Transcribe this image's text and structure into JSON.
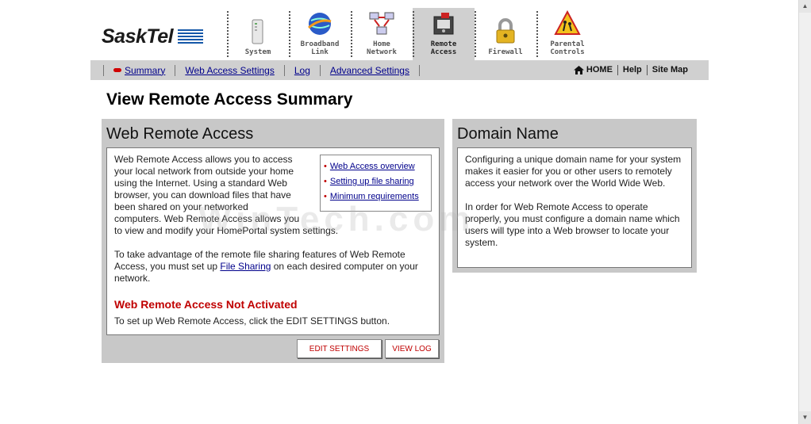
{
  "brand": {
    "name": "SaskTel"
  },
  "nav_tabs": [
    {
      "label_line1": "System",
      "label_line2": "",
      "icon": "system-tower-icon",
      "active": false
    },
    {
      "label_line1": "Broadband",
      "label_line2": "Link",
      "icon": "globe-icon",
      "active": false
    },
    {
      "label_line1": "Home",
      "label_line2": "Network",
      "icon": "network-computers-icon",
      "active": false
    },
    {
      "label_line1": "Remote",
      "label_line2": "Access",
      "icon": "remote-access-icon",
      "active": true
    },
    {
      "label_line1": "Firewall",
      "label_line2": "",
      "icon": "padlock-icon",
      "active": false
    },
    {
      "label_line1": "Parental",
      "label_line2": "Controls",
      "icon": "warning-sign-icon",
      "active": false
    }
  ],
  "subnav": {
    "items": [
      "Summary",
      "Web Access Settings",
      "Log",
      "Advanced Settings"
    ],
    "active": "Summary",
    "right_links": [
      "HOME",
      "Help",
      "Site Map"
    ]
  },
  "page_title": "View Remote Access Summary",
  "web_remote_access": {
    "title": "Web Remote Access",
    "intro_lines": [
      "Web Remote Access allows you to access",
      "your local network from outside your home",
      "using the Internet. Using a standard Web",
      "browser, you can download files that have",
      "been shared on your networked",
      "computers. Web Remote Access allows you",
      "to view and modify your HomePortal system settings."
    ],
    "links": [
      "Web Access overview",
      "Setting up file sharing",
      "Minimum requirements"
    ],
    "para2_before": "To take advantage of the remote file sharing features of Web Remote Access, you must set up ",
    "para2_link": "File Sharing",
    "para2_after": " on each desired computer on your network.",
    "status": "Web Remote Access Not Activated",
    "instructions": "To set up Web Remote Access, click the EDIT SETTINGS button.",
    "edit_button": "EDIT SETTINGS",
    "view_log_button": "VIEW LOG"
  },
  "domain_name": {
    "title": "Domain Name",
    "para1": "Configuring a unique domain name for your system makes it easier for you or other users to remotely access your network over the World Wide Web.",
    "para2": "In order for Web Remote Access to operate properly, you must configure a domain name which users will type into a Web browser to locate your system."
  },
  "watermark": "WinTech.com",
  "colors": {
    "accent_red": "#c00000",
    "link_blue": "#00008b",
    "panel_gray": "#c8c8c8",
    "logo_blue": "#1457a8"
  }
}
